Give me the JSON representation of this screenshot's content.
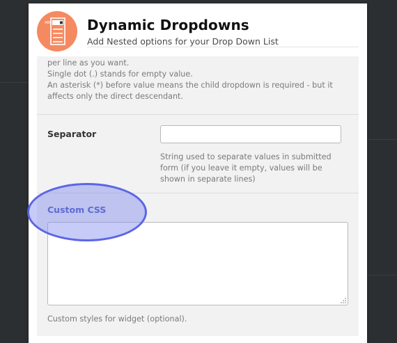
{
  "app": {
    "title": "Dynamic Dropdowns",
    "subtitle": "Add Nested options for your Drop Down List",
    "icon": "dropdown-list-icon",
    "icon_color": "#f58a61",
    "icon_text": "ABC"
  },
  "options_help": {
    "line1": "per line as you want.",
    "line2": "Single dot (.) stands for empty value.",
    "line3": "An asterisk (*) before value means the child dropdown is required - but it",
    "line4": "affects only the direct descendant."
  },
  "separator": {
    "label": "Separator",
    "value": "",
    "help_line1": "String used to separate values in submitted",
    "help_line2": "form (if you leave it empty, values will be",
    "help_line3": "shown in separate lines)"
  },
  "custom_css": {
    "label": "Custom CSS",
    "value": "",
    "help": "Custom styles for widget (optional).",
    "label_color": "#4d5bc0"
  },
  "highlight_color": "#555fe6"
}
